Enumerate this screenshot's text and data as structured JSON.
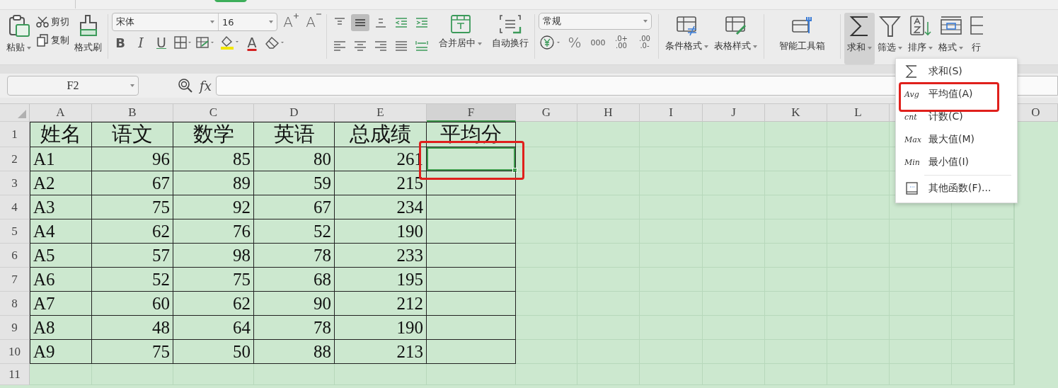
{
  "ribbon": {
    "clipboard": {
      "paste": "粘贴",
      "cut": "剪切",
      "copy": "复制",
      "format_painter": "格式刷"
    },
    "font": {
      "family": "宋体",
      "size": "16",
      "grow": "A",
      "shrink": "A",
      "bold": "B",
      "italic": "I",
      "underline": "U",
      "font_color": "A"
    },
    "alignment": {
      "buttons": [
        {
          "kind": "top",
          "selected": false
        },
        {
          "kind": "middle",
          "selected": true
        },
        {
          "kind": "bottom",
          "selected": false
        },
        {
          "kind": "outdent",
          "selected": false
        },
        {
          "kind": "indent",
          "selected": false
        },
        {
          "kind": "left",
          "selected": false
        },
        {
          "kind": "center",
          "selected": false
        },
        {
          "kind": "right",
          "selected": false
        },
        {
          "kind": "justify",
          "selected": false
        },
        {
          "kind": "distributed",
          "selected": false
        }
      ],
      "merge": "合并居中",
      "wrap": "自动换行"
    },
    "number": {
      "format": "常规",
      "buttons": [
        {
          "kind": "percent",
          "text": "%"
        },
        {
          "kind": "thousands",
          "text": "000"
        },
        {
          "kind": "increase_decimal",
          "text": ".0+ .00"
        },
        {
          "kind": "decrease_decimal",
          "text": ".00 .0-"
        }
      ]
    },
    "tools": [
      {
        "kind": "conditional",
        "label": "条件格式",
        "dropdown": true,
        "pressed": false
      },
      {
        "kind": "table_style",
        "label": "表格样式",
        "dropdown": true,
        "pressed": false
      },
      {
        "kind": "toolbox",
        "label": "智能工具箱",
        "dropdown": false,
        "pressed": false
      },
      {
        "kind": "sum",
        "label": "求和",
        "dropdown": true,
        "pressed": true
      },
      {
        "kind": "filter",
        "label": "筛选",
        "dropdown": true,
        "pressed": false
      },
      {
        "kind": "sort",
        "label": "排序",
        "dropdown": true,
        "pressed": false
      },
      {
        "kind": "format",
        "label": "格式",
        "dropdown": true,
        "pressed": false
      },
      {
        "kind": "rowcol",
        "label": "行",
        "dropdown": false,
        "pressed": false
      }
    ]
  },
  "formula_bar": {
    "name_box": "F2",
    "fx": "fx"
  },
  "sheet": {
    "columns": [
      "A",
      "B",
      "C",
      "D",
      "E",
      "F",
      "G",
      "H",
      "I",
      "J",
      "K",
      "L"
    ],
    "columns_right": [
      "O"
    ],
    "header_row": {
      "num": "1",
      "cells": [
        "姓名",
        "语文",
        "数学",
        "英语",
        "总成绩",
        "平均分"
      ]
    },
    "rows": [
      {
        "num": "2",
        "cells": [
          "A1",
          "96",
          "85",
          "80",
          "261"
        ],
        "result_selected": true,
        "result_marked": true
      },
      {
        "num": "3",
        "cells": [
          "A2",
          "67",
          "89",
          "59",
          "215"
        ],
        "result_selected": false,
        "result_marked": false
      },
      {
        "num": "4",
        "cells": [
          "A3",
          "75",
          "92",
          "67",
          "234"
        ],
        "result_selected": false,
        "result_marked": false
      },
      {
        "num": "5",
        "cells": [
          "A4",
          "62",
          "76",
          "52",
          "190"
        ],
        "result_selected": false,
        "result_marked": false
      },
      {
        "num": "6",
        "cells": [
          "A5",
          "57",
          "98",
          "78",
          "233"
        ],
        "result_selected": false,
        "result_marked": false
      },
      {
        "num": "7",
        "cells": [
          "A6",
          "52",
          "75",
          "68",
          "195"
        ],
        "result_selected": false,
        "result_marked": false
      },
      {
        "num": "8",
        "cells": [
          "A7",
          "60",
          "62",
          "90",
          "212"
        ],
        "result_selected": false,
        "result_marked": false
      },
      {
        "num": "9",
        "cells": [
          "A8",
          "48",
          "64",
          "78",
          "190"
        ],
        "result_selected": false,
        "result_marked": false
      },
      {
        "num": "10",
        "cells": [
          "A9",
          "75",
          "50",
          "88",
          "213"
        ],
        "result_selected": false,
        "result_marked": false
      }
    ],
    "extra_rows": [
      "11"
    ]
  },
  "sum_menu": {
    "items": [
      {
        "kind": "sigma",
        "label": "求和(S)",
        "marked": false,
        "separator_before": false
      },
      {
        "kind": "text",
        "icon": "Avg",
        "label": "平均值(A)",
        "marked": true,
        "separator_before": false
      },
      {
        "kind": "text",
        "icon": "cnt",
        "label": "计数(C)",
        "marked": false,
        "separator_before": false
      },
      {
        "kind": "text",
        "icon": "Max",
        "label": "最大值(M)",
        "marked": false,
        "separator_before": false
      },
      {
        "kind": "text",
        "icon": "Min",
        "label": "最小值(I)",
        "marked": false,
        "separator_before": false
      },
      {
        "kind": "book",
        "label": "其他函数(F)...",
        "marked": false,
        "separator_before": true
      }
    ]
  }
}
